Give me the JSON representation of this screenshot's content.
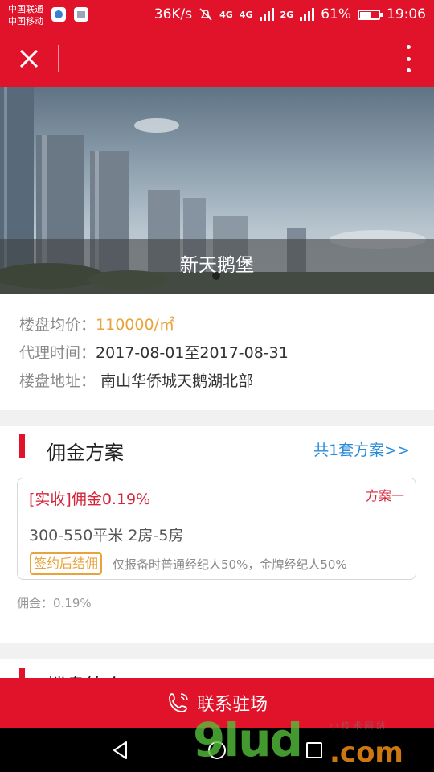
{
  "status_bar": {
    "carrier_1": "中国联通",
    "carrier_2": "中国移动",
    "speed": "36K/s",
    "network_1": "4G",
    "network_2": "4G",
    "network_3": "2G",
    "battery": "61%",
    "battery_level": 0.61,
    "time": "19:06"
  },
  "app_bar": {
    "close_icon": "close-icon",
    "more_icon": "more-vertical-icon"
  },
  "hero": {
    "title": "新天鹅堡"
  },
  "info": {
    "price_label": "楼盘均价：",
    "price_value": "110000/㎡",
    "agent_period_label": "代理时间：",
    "agent_period_value": "2017-08-01至2017-08-31",
    "address_label": "楼盘地址：",
    "address_value": "南山华侨城天鹅湖北部"
  },
  "commission": {
    "title": "佣金方案",
    "link": "共1套方案>>",
    "plan": {
      "title": "[实收]佣金0.19%",
      "tag": "方案一",
      "size": "300-550平米 2房-5房",
      "badge": "签约后结佣",
      "desc": "仅报备时普通经纪人50%，金牌经纪人50%"
    },
    "note": "佣金：0.19%"
  },
  "next_section": {
    "title": "楼盘简介"
  },
  "contact": {
    "label": "联系驻场",
    "icon": "phone-icon"
  },
  "watermark": {
    "big": "9lud",
    "com": ".com",
    "small": "小 技 术 网 站"
  },
  "colors": {
    "brand_red": "#e0132a",
    "price_orange": "#e8a33a",
    "link_blue": "#2a8bd8"
  }
}
